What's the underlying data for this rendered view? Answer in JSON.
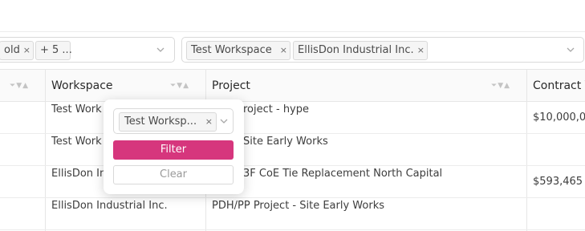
{
  "filters": {
    "select_left": {
      "tags": [
        {
          "label": "old",
          "remove": "×"
        },
        {
          "label": "+ 5 ..."
        }
      ]
    },
    "select_right": {
      "tags": [
        {
          "label": "Test Workspace",
          "remove": "×"
        },
        {
          "label": "EllisDon Industrial Inc.",
          "remove": "×"
        }
      ]
    }
  },
  "table": {
    "columns": {
      "workspace": "Workspace",
      "project": "Project",
      "contract": "Contract V"
    },
    "sort_glyphs": "⏷▼▲",
    "rows": [
      {
        "workspace": "Test Work",
        "project": "roject - hype",
        "contract": "$10,000,00"
      },
      {
        "workspace": "Test Work",
        "project": "Site Early Works",
        "contract": ""
      },
      {
        "workspace": "EllisDon In",
        "project": "3F CoE Tie Replacement North Capital",
        "contract": "$593,465"
      },
      {
        "workspace": "EllisDon Industrial Inc.",
        "project": "PDH/PP Project - Site Early Works",
        "contract": ""
      }
    ]
  },
  "popup": {
    "selected_tag": "Test Worksp...",
    "remove": "×",
    "filter_label": "Filter",
    "clear_label": "Clear"
  },
  "colors": {
    "accent": "#d6367d",
    "border": "#d9d9d9",
    "header_bg": "#fafafa"
  },
  "icons": [
    "close-icon",
    "chevron-down-icon",
    "filter-icon",
    "sort-down-icon",
    "sort-up-icon"
  ]
}
